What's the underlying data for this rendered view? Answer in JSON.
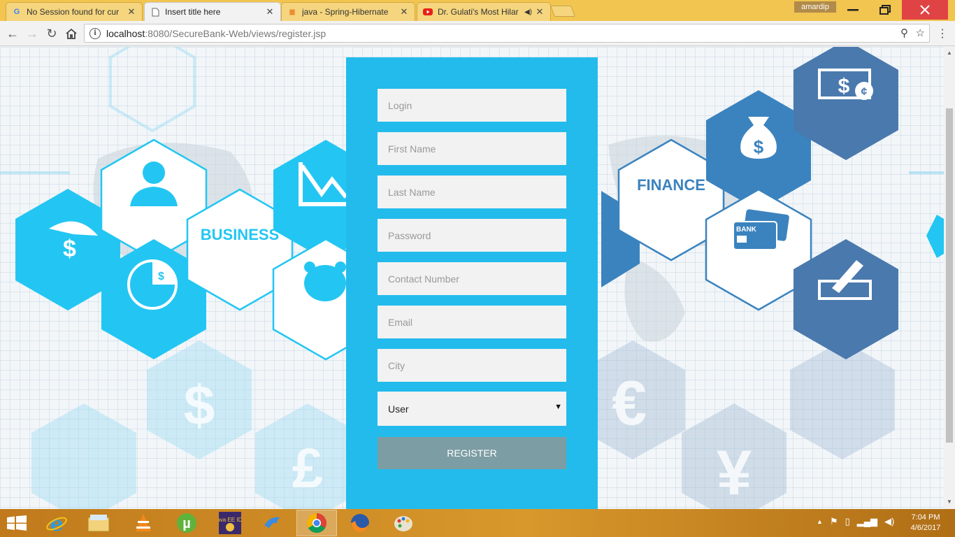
{
  "browser": {
    "tabs": [
      {
        "title": "No Session found for cur",
        "icon": "google-icon"
      },
      {
        "title": "Insert title here",
        "icon": "page-icon",
        "active": true
      },
      {
        "title": "java - Spring-Hibernate",
        "icon": "stackoverflow-icon"
      },
      {
        "title": "Dr. Gulati's Most Hilar",
        "icon": "youtube-icon",
        "audio": true
      }
    ],
    "user": "amardip",
    "url_host": "localhost",
    "url_path": ":8080/SecureBank-Web/views/register.jsp"
  },
  "background": {
    "business_label": "BUSINESS",
    "finance_label": "FINANCE",
    "bank_label": "BANK"
  },
  "form": {
    "fields": [
      {
        "placeholder": "Login"
      },
      {
        "placeholder": "First Name"
      },
      {
        "placeholder": "Last Name"
      },
      {
        "placeholder": "Password"
      },
      {
        "placeholder": "Contact Number"
      },
      {
        "placeholder": "Email"
      },
      {
        "placeholder": "City"
      }
    ],
    "role_selected": "User",
    "submit_label": "REGISTER"
  },
  "taskbar": {
    "apps": [
      "internet-explorer-icon",
      "file-explorer-icon",
      "vlc-icon",
      "utorrent-icon",
      "eclipse-javaee-icon",
      "dolphin-icon",
      "chrome-icon",
      "firefox-icon",
      "paint-icon"
    ],
    "app_label_javaee": "Java EE IDE",
    "time": "7:04 PM",
    "date": "4/6/2017"
  },
  "colors": {
    "panel": "#23bbec",
    "button": "#7c9da3",
    "taskbar": "#d08c25"
  }
}
